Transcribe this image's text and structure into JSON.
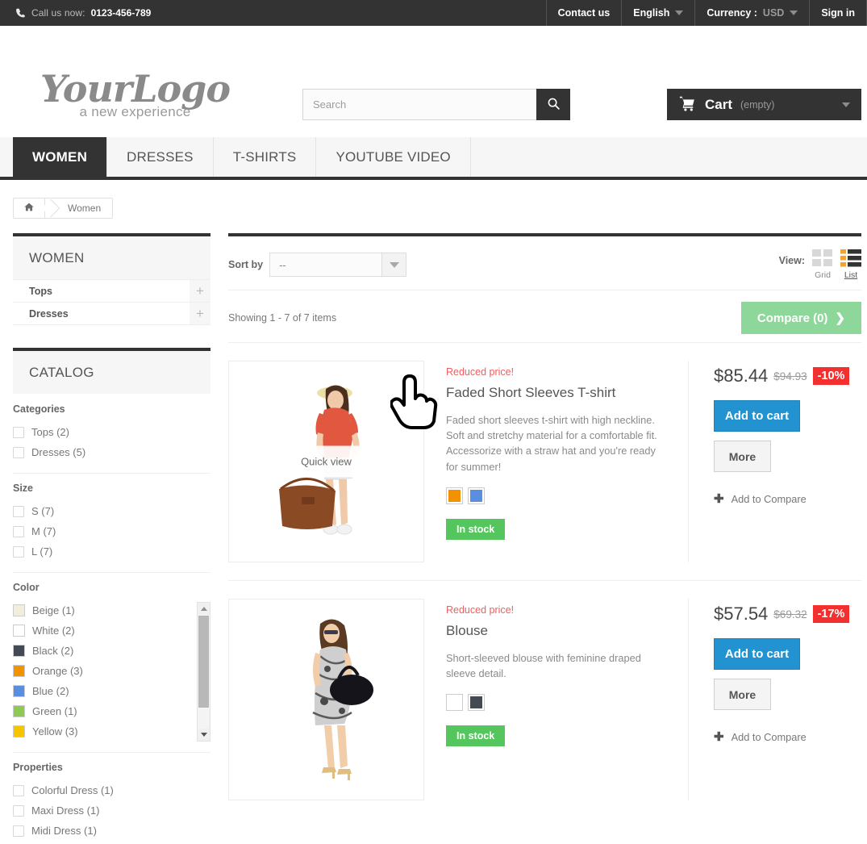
{
  "topbar": {
    "phone_icon": "phone-icon",
    "call_text": "Call us now:",
    "call_number": "0123-456-789",
    "contact": "Contact us",
    "language": "English",
    "currency_label": "Currency :",
    "currency_value": "USD",
    "signin": "Sign in"
  },
  "header": {
    "logo_main": "YourLogo",
    "logo_sub": "a new experience",
    "search_placeholder": "Search",
    "search_value": "",
    "search_icon": "search-icon",
    "cart_icon": "cart-icon",
    "cart_label": "Cart",
    "cart_status": "(empty)"
  },
  "menu": [
    {
      "label": "WOMEN",
      "active": true
    },
    {
      "label": "DRESSES",
      "active": false
    },
    {
      "label": "T-SHIRTS",
      "active": false
    },
    {
      "label": "YOUTUBE VIDEO",
      "active": false
    }
  ],
  "breadcrumb": {
    "home_icon": "home-icon",
    "current": "Women"
  },
  "sidebar": {
    "category_title": "WOMEN",
    "subcategories": [
      {
        "label": "Tops",
        "expand": "+"
      },
      {
        "label": "Dresses",
        "expand": "+"
      }
    ],
    "catalog_title": "CATALOG",
    "filters": [
      {
        "head": "Categories",
        "type": "checkbox",
        "options": [
          {
            "label": "Tops (2)"
          },
          {
            "label": "Dresses (5)"
          }
        ]
      },
      {
        "head": "Size",
        "type": "checkbox",
        "options": [
          {
            "label": "S (7)"
          },
          {
            "label": "M (7)"
          },
          {
            "label": "L (7)"
          }
        ]
      },
      {
        "head": "Color",
        "type": "swatch",
        "scrollable": true,
        "options": [
          {
            "label": "Beige (1)",
            "color": "#f1eedc"
          },
          {
            "label": "White (2)",
            "color": "#ffffff"
          },
          {
            "label": "Black (2)",
            "color": "#434a54"
          },
          {
            "label": "Orange (3)",
            "color": "#f39200"
          },
          {
            "label": "Blue (2)",
            "color": "#5a8ee0"
          },
          {
            "label": "Green (1)",
            "color": "#8ec951"
          },
          {
            "label": "Yellow (3)",
            "color": "#f5c600"
          }
        ]
      },
      {
        "head": "Properties",
        "type": "checkbox",
        "options": [
          {
            "label": "Colorful Dress (1)"
          },
          {
            "label": "Maxi Dress (1)"
          },
          {
            "label": "Midi Dress (1)"
          }
        ]
      }
    ]
  },
  "toolbar": {
    "sort_label": "Sort by",
    "sort_value": "--",
    "view_label": "View:",
    "view_grid": "Grid",
    "view_list": "List",
    "view_active": "List",
    "count_text": "Showing 1 - 7 of 7 items",
    "compare_label": "Compare (0)",
    "compare_arrow": "❯"
  },
  "products": [
    {
      "badge": "Reduced price!",
      "name": "Faded Short Sleeves T-shirt",
      "description": "Faded short sleeves t-shirt with high neckline. Soft and stretchy material for a comfortable fit. Accessorize with a straw hat and you're ready for summer!",
      "quickview": "Quick view",
      "colors": [
        "#f39200",
        "#5a8ee0"
      ],
      "stock": "In stock",
      "price_new": "$85.44",
      "price_old": "$94.93",
      "discount": "-10%",
      "add_to_cart": "Add to cart",
      "more": "More",
      "add_compare": "Add to Compare",
      "has_cursor": true
    },
    {
      "badge": "Reduced price!",
      "name": "Blouse",
      "description": "Short-sleeved blouse with feminine draped sleeve detail.",
      "quickview": "",
      "colors": [
        "#ffffff",
        "#434a54"
      ],
      "stock": "In stock",
      "price_new": "$57.54",
      "price_old": "$69.32",
      "discount": "-17%",
      "add_to_cart": "Add to cart",
      "more": "More",
      "add_compare": "Add to Compare",
      "has_cursor": false
    }
  ],
  "colors": {
    "accent_blue": "#2293d0",
    "accent_red": "#f2302f",
    "accent_green": "#55c65e",
    "compare_green": "#8ed79a",
    "dark": "#333333",
    "reduced_text": "#ef5f5f"
  }
}
